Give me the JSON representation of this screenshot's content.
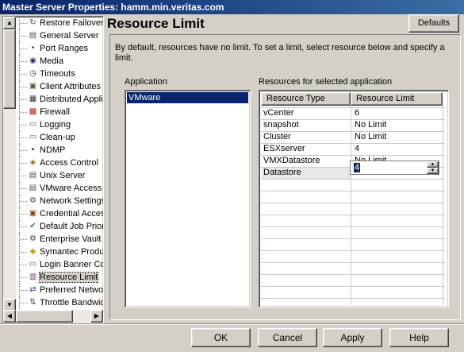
{
  "window": {
    "title": "Master Server Properties: hamm.min.veritas.com"
  },
  "tree": {
    "items": [
      {
        "label": "Restore Failover",
        "icon": "restore-failover-icon",
        "glyph": "↻",
        "color": "#7a3b3b"
      },
      {
        "label": "General Server",
        "icon": "server-icon",
        "glyph": "▤",
        "color": "#555555"
      },
      {
        "label": "Port Ranges",
        "icon": "port-icon",
        "glyph": "•",
        "color": "#333333"
      },
      {
        "label": "Media",
        "icon": "media-icon",
        "glyph": "◉",
        "color": "#2a2a6a"
      },
      {
        "label": "Timeouts",
        "icon": "clock-icon",
        "glyph": "◷",
        "color": "#333333"
      },
      {
        "label": "Client Attributes",
        "icon": "client-attributes-icon",
        "glyph": "▣",
        "color": "#6a5a2a"
      },
      {
        "label": "Distributed Application Restore Mapping",
        "icon": "distributed-app-icon",
        "glyph": "▦",
        "color": "#3a3a3a"
      },
      {
        "label": "Firewall",
        "icon": "firewall-icon",
        "glyph": "▩",
        "color": "#b22222"
      },
      {
        "label": "Logging",
        "icon": "logging-icon",
        "glyph": "▭",
        "color": "#555555"
      },
      {
        "label": "Clean-up",
        "icon": "cleanup-icon",
        "glyph": "▭",
        "color": "#555555"
      },
      {
        "label": "NDMP",
        "icon": "ndmp-icon",
        "glyph": "▪",
        "color": "#333333"
      },
      {
        "label": "Access Control",
        "icon": "access-control-icon",
        "glyph": "◈",
        "color": "#8b6914"
      },
      {
        "label": "Unix Server",
        "icon": "unix-server-icon",
        "glyph": "▤",
        "color": "#555555"
      },
      {
        "label": "VMware Access Hosts",
        "icon": "vmware-hosts-icon",
        "glyph": "▤",
        "color": "#555555"
      },
      {
        "label": "Network Settings",
        "icon": "network-icon",
        "glyph": "⚙",
        "color": "#444444"
      },
      {
        "label": "Credential Access",
        "icon": "credential-icon",
        "glyph": "▣",
        "color": "#8b4513"
      },
      {
        "label": "Default Job Priorities",
        "icon": "job-priority-icon",
        "glyph": "✔",
        "color": "#2e7d32"
      },
      {
        "label": "Enterprise Vault",
        "icon": "enterprise-vault-icon",
        "glyph": "⚙",
        "color": "#444444"
      },
      {
        "label": "Symantec Products",
        "icon": "symantec-icon",
        "glyph": "◆",
        "color": "#d4a017"
      },
      {
        "label": "Login Banner Configuration",
        "icon": "login-banner-icon",
        "glyph": "▭",
        "color": "#555555"
      },
      {
        "label": "Resource Limit",
        "icon": "resource-limit-icon",
        "glyph": "▥",
        "color": "#7a3b7a",
        "selected": true
      },
      {
        "label": "Preferred Network",
        "icon": "preferred-network-icon",
        "glyph": "⇄",
        "color": "#2a4a8a"
      },
      {
        "label": "Throttle Bandwidth",
        "icon": "throttle-icon",
        "glyph": "⇅",
        "color": "#2a4a8a"
      }
    ]
  },
  "content": {
    "title": "Resource Limit",
    "defaults_label": "Defaults",
    "description": "By default, resources have no limit. To set a limit, select resource below and specify a limit.",
    "application_label": "Application",
    "applications": [
      "VMware"
    ],
    "resources_label": "Resources for selected application",
    "table": {
      "headers": [
        "Resource Type",
        "Resource Limit"
      ],
      "rows": [
        {
          "type": "vCenter",
          "limit": "6"
        },
        {
          "type": "snapshot",
          "limit": "No Limit"
        },
        {
          "type": "Cluster",
          "limit": "No Limit"
        },
        {
          "type": "ESXserver",
          "limit": "4"
        },
        {
          "type": "VMXDatastore",
          "limit": "No Limit"
        },
        {
          "type": "Datastore",
          "limit": "4",
          "editing": true
        }
      ]
    }
  },
  "buttons": {
    "ok": "OK",
    "cancel": "Cancel",
    "apply": "Apply",
    "help": "Help"
  }
}
